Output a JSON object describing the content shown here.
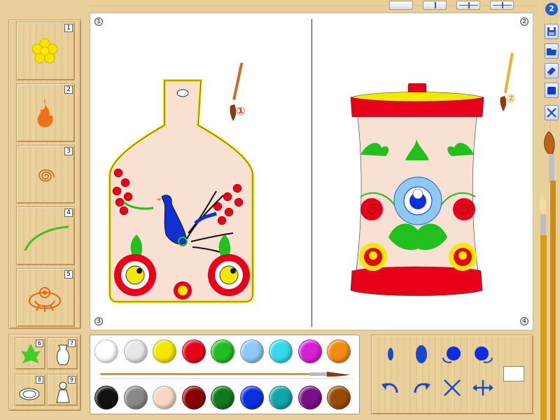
{
  "toolbar": {
    "layouts": [
      "layout-single",
      "layout-vertical-split",
      "layout-horizontal-split",
      "layout-quad-split"
    ]
  },
  "help": {
    "label": "2"
  },
  "right_buttons": [
    "save-icon",
    "open-folder-icon",
    "eraser-icon",
    "fill-shape-icon",
    "close-icon"
  ],
  "canvas": {
    "corner_labels": [
      "1",
      "2",
      "3",
      "4"
    ],
    "marker_labels": [
      "①",
      "②"
    ]
  },
  "stencils": [
    {
      "num": "1",
      "icon": "flower-stencil-icon"
    },
    {
      "num": "2",
      "icon": "flame-stencil-icon"
    },
    {
      "num": "3",
      "icon": "spiral-stencil-icon"
    },
    {
      "num": "4",
      "icon": "curve-stencil-icon"
    },
    {
      "num": "5",
      "icon": "ornament-flower-stencil-icon"
    }
  ],
  "mini_templates": [
    {
      "num": "6",
      "icon": "leaf-template-icon"
    },
    {
      "num": "7",
      "icon": "vase-template-icon"
    },
    {
      "num": "8",
      "icon": "plate-template-icon"
    },
    {
      "num": "9",
      "icon": "doll-template-icon"
    }
  ],
  "palette": {
    "row1": [
      "#ffffff",
      "#e6e6e6",
      "#f5e800",
      "#e8001a",
      "#22c01e",
      "#8ec8f5",
      "#35d9e8",
      "#d81fd6",
      "#f58a10"
    ],
    "row2": [
      "#111111",
      "#888888",
      "#f7d6c6",
      "#8a0000",
      "#0e7a1a",
      "#0a2fe0",
      "#0fa6a8",
      "#7a0f8a",
      "#9a4a08"
    ]
  },
  "tools": [
    "small-brush-icon",
    "large-brush-icon",
    "rotate-left-stamp-icon",
    "rotate-right-stamp-icon",
    "undo-icon",
    "redo-icon",
    "flip-icon",
    "move-icon"
  ]
}
